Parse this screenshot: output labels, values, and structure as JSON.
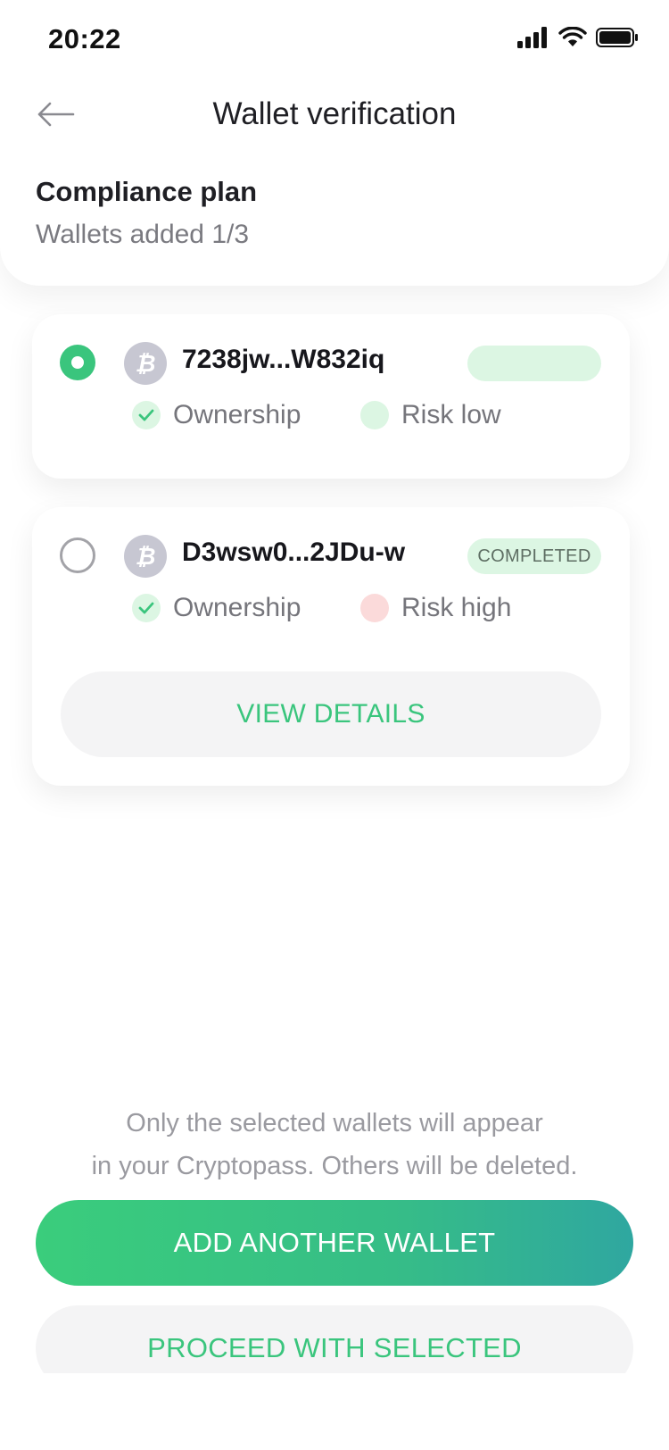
{
  "status_bar": {
    "time": "20:22"
  },
  "nav": {
    "title": "Wallet verification"
  },
  "plan": {
    "title": "Compliance plan",
    "subtitle": "Wallets added 1/3"
  },
  "wallets": [
    {
      "address": "7238jw...W832iq",
      "selected": true,
      "badge": "",
      "ownership_label": "Ownership",
      "risk_label": "Risk low",
      "risk_color": "#dcf6e3"
    },
    {
      "address": "D3wsw0...2JDu-w",
      "selected": false,
      "badge": "COMPLETED",
      "ownership_label": "Ownership",
      "risk_label": "Risk high",
      "risk_color": "#fbdada",
      "details_label": "VIEW DETAILS"
    }
  ],
  "info": {
    "line1": "Only the selected wallets will appear",
    "line2": "in  your  Cryptopass. Others will be deleted."
  },
  "actions": {
    "primary_label": "ADD ANOTHER WALLET",
    "secondary_label": "PROCEED WITH SELECTED"
  },
  "colors": {
    "accent": "#3ac57d",
    "gradient_start": "#3acd7c",
    "gradient_end": "#2fa7a0",
    "badge_bg": "#dcf6e3"
  },
  "icons": {
    "back": "arrow-left-icon",
    "coin": "bitcoin-icon",
    "check": "check-icon",
    "signal": "cellular-signal-icon",
    "wifi": "wifi-icon",
    "battery": "battery-icon"
  }
}
